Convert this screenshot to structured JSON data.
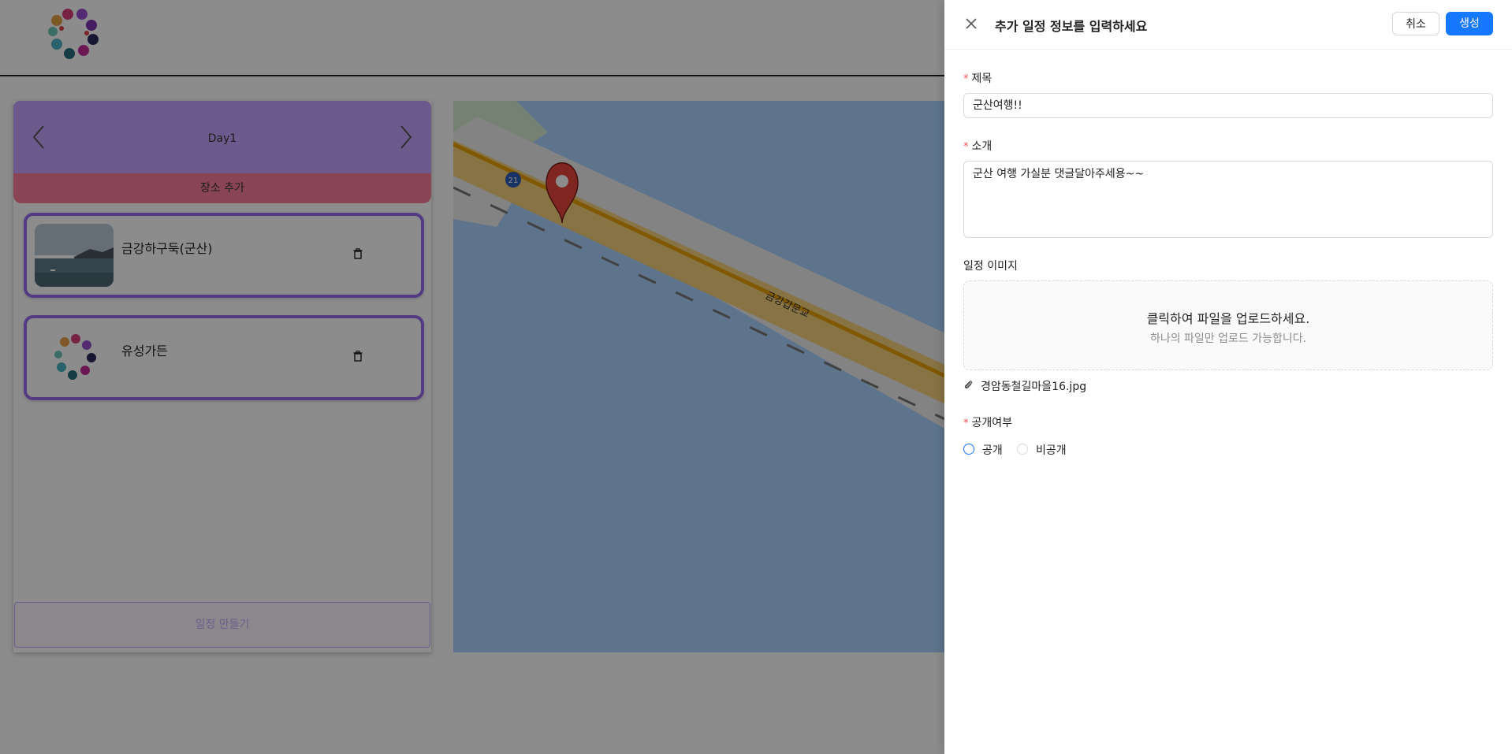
{
  "planner": {
    "day_label": "Day1",
    "add_place_label": "장소 추가",
    "places": [
      {
        "name": "금강하구둑(군산)"
      },
      {
        "name": "유성가든"
      }
    ],
    "make_schedule_label": "일정 만들기"
  },
  "map": {
    "road_number": "21",
    "road_name": "금강갑문교"
  },
  "drawer": {
    "title": "추가 일정 정보를 입력하세요",
    "cancel_label": "취소",
    "create_label": "생성",
    "fields": {
      "title_label": "제목",
      "title_value": "군산여행!!",
      "intro_label": "소개",
      "intro_value": "군산 여행 가실분 댓글달아주세용~~",
      "image_label": "일정 이미지",
      "upload_main": "클릭하여 파일을 업로드하세요.",
      "upload_hint": "하나의 파일만 업로드 가능합니다.",
      "file_name": "경암동철길마을16.jpg",
      "visibility_label": "공개여부",
      "visibility_options": [
        "공개",
        "비공개"
      ]
    }
  },
  "colors": {
    "primary": "#1677ff",
    "day_header": "#c6a5ff",
    "add_place": "#fc7f9c",
    "card_border": "#9b6cf0",
    "required": "#ff4d4f",
    "map_water": "#a9d3ff"
  }
}
